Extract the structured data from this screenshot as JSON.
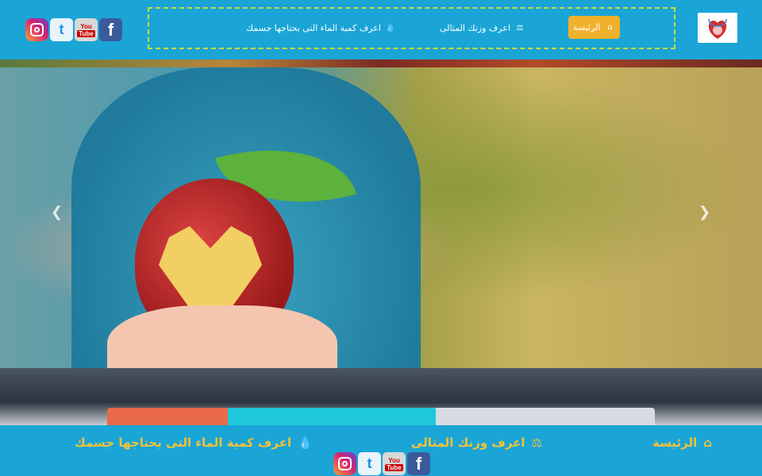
{
  "header": {
    "nav": {
      "home": "الرئيسة",
      "ideal_weight": "اعرف وزنك المثالى",
      "water": "اعرف كمية الماء التى يحتاجها جسمك"
    },
    "colors": {
      "bar": "#1aa5d6",
      "accent": "#f0b12b",
      "border": "#c9dd3a"
    }
  },
  "social": {
    "facebook": "f",
    "youtube_top": "You",
    "youtube_bottom": "Tube",
    "twitter": "t"
  },
  "slider": {
    "prev_icon": "chevron-left-icon",
    "next_icon": "chevron-right-icon",
    "prev": "❮",
    "next": "❯"
  },
  "footer_nav": {
    "home": "الرئيسة",
    "ideal_weight": "اعرف وزنك المثالى",
    "water": "اعرف كمية الماء التى يحتاجها جسمك"
  }
}
